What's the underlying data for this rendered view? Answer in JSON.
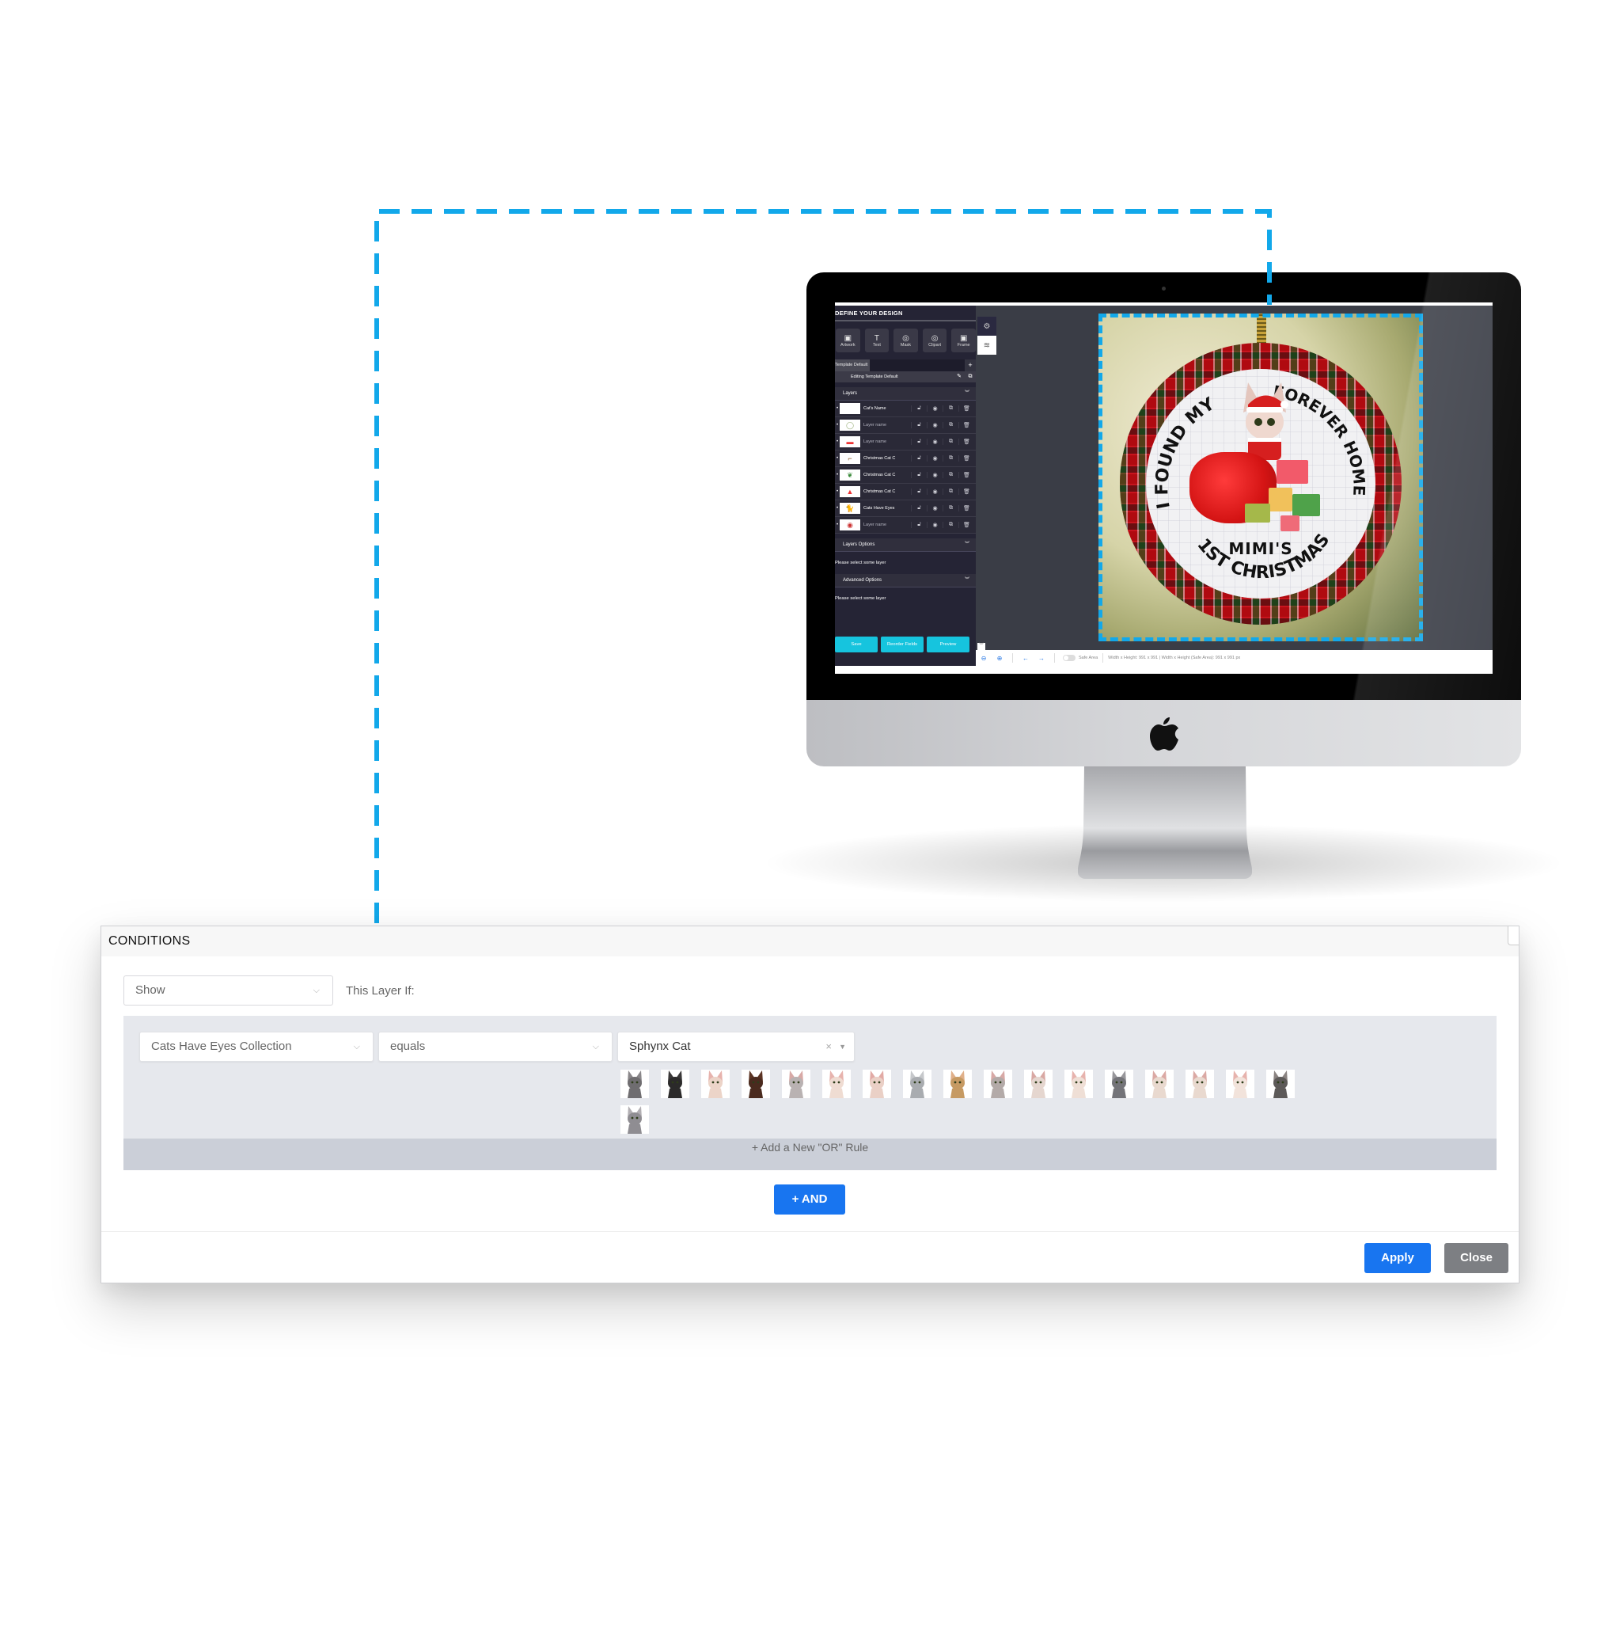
{
  "designer": {
    "panel_title": "DEFINE YOUR DESIGN",
    "tools": [
      {
        "label": "Artwork",
        "icon": "image-icon"
      },
      {
        "label": "Text",
        "icon": "text-icon"
      },
      {
        "label": "Mask",
        "icon": "mask-icon"
      },
      {
        "label": "Clipart",
        "icon": "clipart-icon"
      },
      {
        "label": "Frame",
        "icon": "frame-icon"
      }
    ],
    "template_tab": "Template Default",
    "editing_label": "Editing Template Default",
    "layers_section": "Layers",
    "layers": [
      {
        "name": "Cat's Name",
        "thumb": "text-icon",
        "muted": false
      },
      {
        "name": "Layer name",
        "thumb": "ring-icon",
        "muted": true
      },
      {
        "name": "Layer name",
        "thumb": "gift-icon",
        "muted": true
      },
      {
        "name": "Christmas Cat C",
        "thumb": "branch-icon",
        "muted": false
      },
      {
        "name": "Christmas Cat C",
        "thumb": "holly-icon",
        "muted": false
      },
      {
        "name": "Christmas Cat C",
        "thumb": "santa-hat-icon",
        "muted": false
      },
      {
        "name": "Cats Have Eyes",
        "thumb": "cat-icon",
        "muted": false
      },
      {
        "name": "Layer name",
        "thumb": "ornament-icon",
        "muted": true
      }
    ],
    "layers_options_section": "Layers Options",
    "layers_options_msg": "Please select some layer",
    "advanced_options_section": "Advanced Options",
    "advanced_options_msg": "Please select some layer",
    "buttons": {
      "save": "Save",
      "reorder": "Reorder Fields",
      "preview": "Preview"
    },
    "toolbar": {
      "safe_area_label": "Safe Area",
      "safe_area_on": false,
      "dimensions": "Width x Height: 991 x 991 | Width x Height (Safe Area): 991 x 991 px"
    },
    "artwork": {
      "line1": "I FOUND MY",
      "line2": "FOREVER HOME",
      "name": "MIMI'S",
      "line3": "1ST CHRISTMAS"
    }
  },
  "conditions": {
    "title": "CONDITIONS",
    "action_select": "Show",
    "this_layer_if": "This Layer If:",
    "rule": {
      "field": "Cats Have Eyes Collection",
      "operator": "equals",
      "value": "Sphynx Cat",
      "clear_icon": "×",
      "options_count": 18
    },
    "cat_variants": [
      {
        "body": "#6f6d70",
        "ear": "#8a878a"
      },
      {
        "body": "#2b2a2a",
        "ear": "#3a3838"
      },
      {
        "body": "#ecd4c8",
        "ear": "#e7b3ad"
      },
      {
        "body": "#4a2a1e",
        "ear": "#5c3424"
      },
      {
        "body": "#b9b2b2",
        "ear": "#d8a9a6"
      },
      {
        "body": "#efdcd2",
        "ear": "#e7b3ad"
      },
      {
        "body": "#ead0c6",
        "ear": "#e2aaa5"
      },
      {
        "body": "#a9acb0",
        "ear": "#c6c8cb"
      },
      {
        "body": "#c69a63",
        "ear": "#e0b08a"
      },
      {
        "body": "#b3aaa8",
        "ear": "#d8a9a6"
      },
      {
        "body": "#e5d6cf",
        "ear": "#d9a8a3"
      },
      {
        "body": "#efdfd6",
        "ear": "#e7b3ad"
      },
      {
        "body": "#747479",
        "ear": "#98979b"
      },
      {
        "body": "#e9d9cf",
        "ear": "#dba9a4"
      },
      {
        "body": "#e9d9cf",
        "ear": "#dba9a4"
      },
      {
        "body": "#f2e3db",
        "ear": "#e7b3ad"
      },
      {
        "body": "#5d5a59",
        "ear": "#8b8482"
      },
      {
        "body": "#8f8d92",
        "ear": "#b2afb3"
      }
    ],
    "add_or_rule": "+ Add a New \"OR\" Rule",
    "add_and": "+ AND",
    "apply": "Apply",
    "close": "Close"
  },
  "colors": {
    "accent_blue": "#1875f0",
    "connector_blue": "#12a8ea",
    "designer_button": "#16c4de",
    "designer_panel": "#252435",
    "close_gray": "#7d7f83"
  }
}
